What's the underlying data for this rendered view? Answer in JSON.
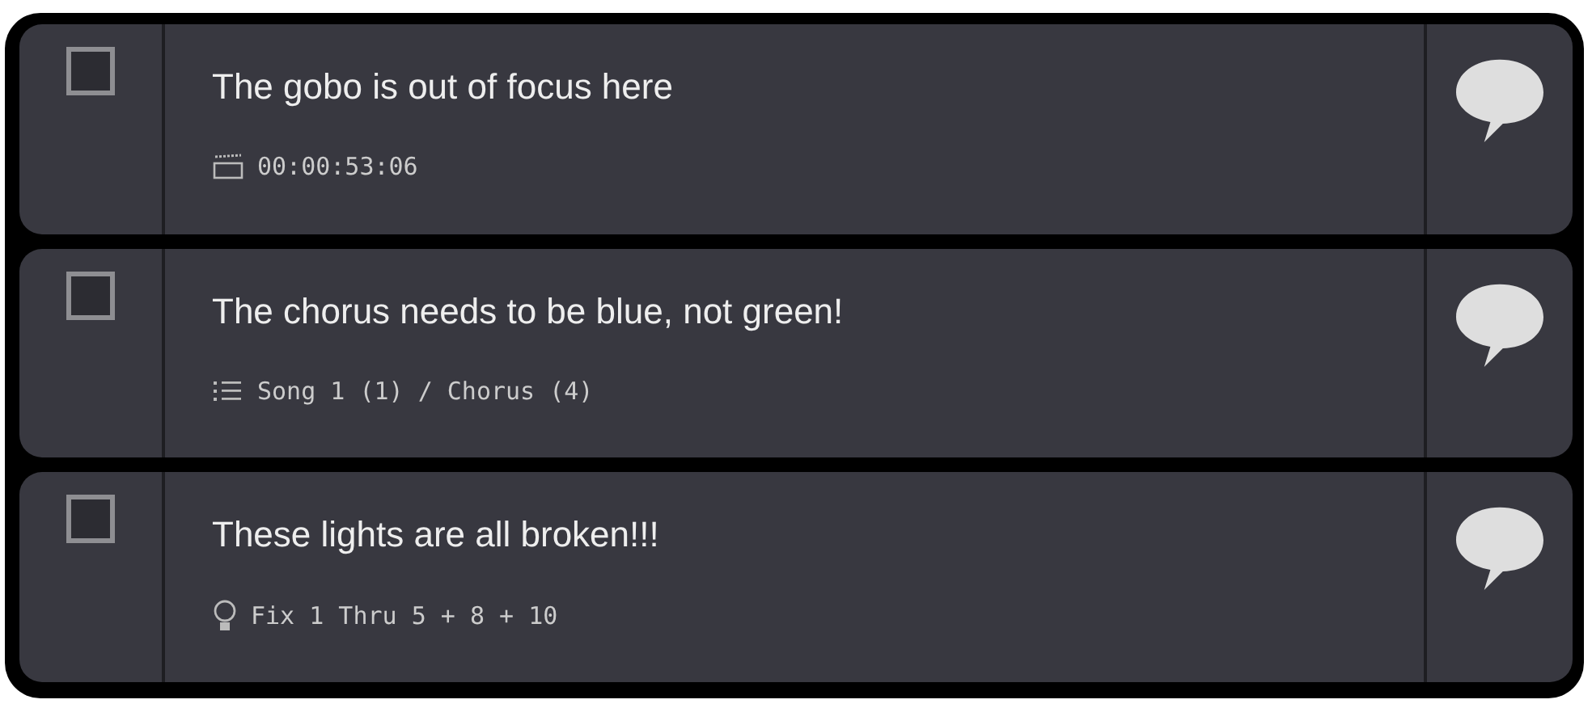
{
  "notes": [
    {
      "text": "The gobo is out of focus here",
      "checked": false,
      "meta": {
        "kind": "timecode",
        "text": "00:00:53:06"
      }
    },
    {
      "text": "The chorus needs to be blue, not green!",
      "checked": false,
      "meta": {
        "kind": "cue",
        "text": "Song 1 (1) / Chorus (4)"
      }
    },
    {
      "text": "These lights are all broken!!!",
      "checked": false,
      "meta": {
        "kind": "fixture",
        "text": "Fix 1 Thru 5 + 8 + 10"
      }
    }
  ]
}
